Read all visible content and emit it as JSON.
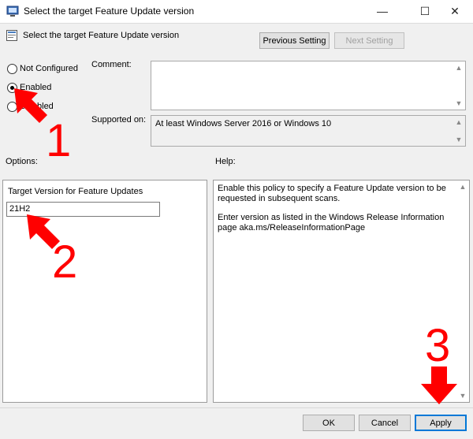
{
  "window": {
    "title": "Select the target Feature Update version",
    "min_glyph": "—",
    "max_glyph": "☐",
    "close_glyph": "✕"
  },
  "header": {
    "title": "Select the target Feature Update version",
    "prev_label": "Previous Setting",
    "next_label": "Next Setting"
  },
  "state": {
    "not_configured": "Not Configured",
    "enabled": "Enabled",
    "disabled": "Disabled",
    "selected": "enabled"
  },
  "comment": {
    "label": "Comment:",
    "value": ""
  },
  "supported": {
    "label": "Supported on:",
    "value": "At least Windows Server 2016 or Windows 10"
  },
  "options": {
    "label": "Options:",
    "field_label": "Target Version for Feature Updates",
    "field_value": "21H2"
  },
  "help": {
    "label": "Help:",
    "para1": "Enable this policy to specify a Feature Update version to be requested in subsequent scans.",
    "para2": "Enter version as listed in the Windows Release Information page aka.ms/ReleaseInformationPage"
  },
  "footer": {
    "ok_label": "OK",
    "cancel_label": "Cancel",
    "apply_label": "Apply"
  },
  "annotations": {
    "step1": "1",
    "step2": "2",
    "step3": "3",
    "color": "#ff0000"
  }
}
